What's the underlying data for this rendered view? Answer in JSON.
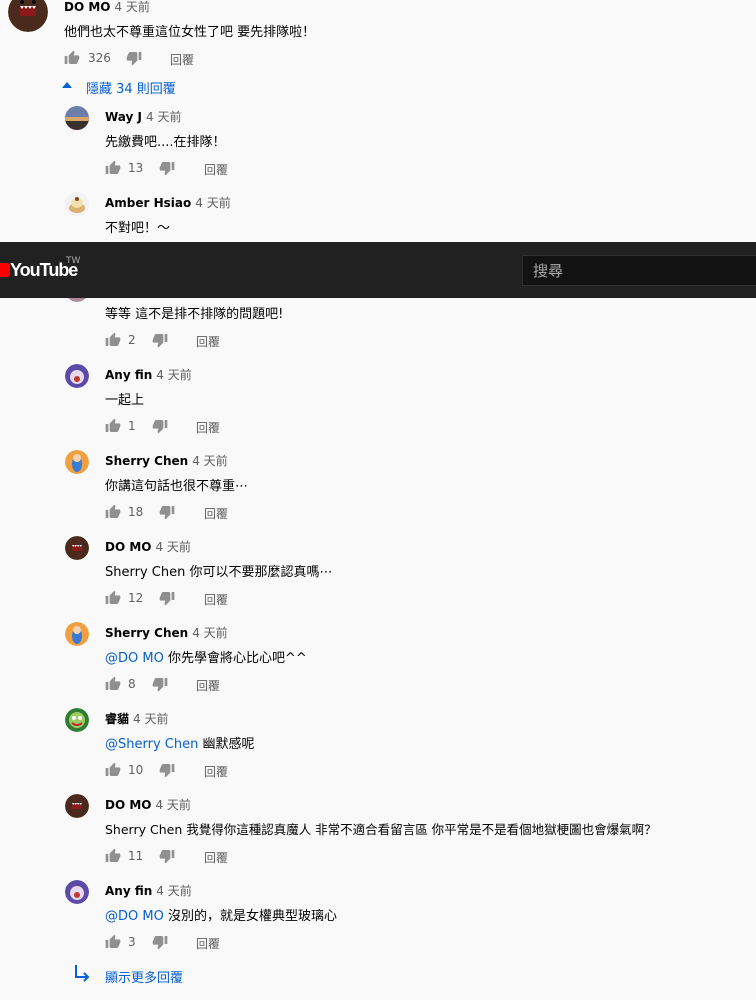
{
  "top_comment": {
    "author": "DO MO",
    "time": "4 天前",
    "text": "他們也太不尊重這位女性了吧 要先排隊啦！",
    "likes": "326",
    "reply_label": "回覆"
  },
  "hide_replies_label": "隱藏 34 則回覆",
  "replies": [
    {
      "author": "Way J",
      "time": "4 天前",
      "text": "先繳費吧....在排隊！",
      "likes": "13",
      "reply_label": "回覆"
    },
    {
      "author": "Amber Hsiao",
      "time": "4 天前",
      "text": "不對吧！～",
      "likes": "",
      "reply_label": "回覆"
    },
    {
      "author": "",
      "time": "",
      "text": "等等 這不是排不排隊的問題吧!",
      "likes": "2",
      "reply_label": "回覆"
    },
    {
      "author": "Any fin",
      "time": "4 天前",
      "text": "一起上",
      "likes": "1",
      "reply_label": "回覆"
    },
    {
      "author": "Sherry Chen",
      "time": "4 天前",
      "text": "你講這句話也很不尊重⋯",
      "likes": "18",
      "reply_label": "回覆"
    },
    {
      "author": "DO MO",
      "time": "4 天前",
      "text": "Sherry Chen 你可以不要那麼認真嗎⋯",
      "likes": "12",
      "reply_label": "回覆"
    },
    {
      "author": "Sherry Chen",
      "time": "4 天前",
      "mention": "@DO MO",
      "text": " 你先學會將心比心吧^^",
      "likes": "8",
      "reply_label": "回覆"
    },
    {
      "author": "睿貓",
      "time": "4 天前",
      "mention": "@Sherry Chen",
      "text": " 幽默感呢",
      "likes": "10",
      "reply_label": "回覆"
    },
    {
      "author": "DO MO",
      "time": "4 天前",
      "text": "Sherry Chen 我覺得你這種認真魔人 非常不適合看留言區 你平常是不是看個地獄梗圖也會爆氣啊？",
      "likes": "11",
      "reply_label": "回覆"
    },
    {
      "author": "Any fin",
      "time": "4 天前",
      "mention": "@DO MO",
      "text": " 沒別的，就是女權典型玻璃心",
      "likes": "3",
      "reply_label": "回覆"
    }
  ],
  "show_more_label": "顯示更多回覆",
  "masthead": {
    "logo_text": "YouTube",
    "region": "TW",
    "search_placeholder": "搜尋"
  },
  "colors": {
    "link": "#065fd4",
    "masthead": "#212121",
    "background": "#f9f9f9"
  }
}
